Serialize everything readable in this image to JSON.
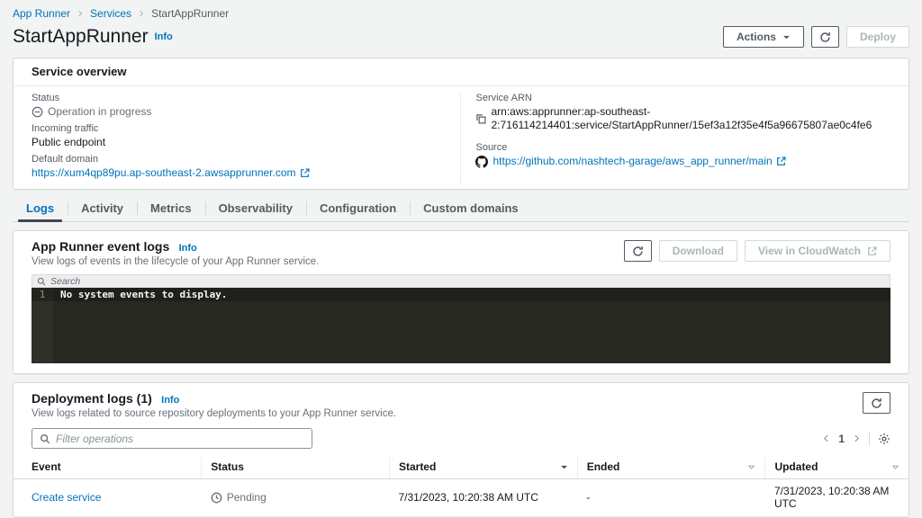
{
  "colors": {
    "link": "#0073bb",
    "active_tab_underline": "#424650",
    "editor_background": "#272822",
    "status_gray": "#687078"
  },
  "breadcrumb": {
    "items": [
      "App Runner",
      "Services",
      "StartAppRunner"
    ]
  },
  "header": {
    "title": "StartAppRunner",
    "info_label": "Info",
    "actions_button": "Actions",
    "deploy_button": "Deploy"
  },
  "service_overview": {
    "title": "Service overview",
    "status_label": "Status",
    "status_value": "Operation in progress",
    "incoming_traffic_label": "Incoming traffic",
    "incoming_traffic_value": "Public endpoint",
    "default_domain_label": "Default domain",
    "default_domain_value": "https://xum4qp89pu.ap-southeast-2.awsapprunner.com",
    "service_arn_label": "Service ARN",
    "service_arn_value": "arn:aws:apprunner:ap-southeast-2:716114214401:service/StartAppRunner/15ef3a12f35e4f5a96675807ae0c4fe6",
    "source_label": "Source",
    "source_value": "https://github.com/nashtech-garage/aws_app_runner/main"
  },
  "tabs": [
    {
      "label": "Logs",
      "active": true
    },
    {
      "label": "Activity",
      "active": false
    },
    {
      "label": "Metrics",
      "active": false
    },
    {
      "label": "Observability",
      "active": false
    },
    {
      "label": "Configuration",
      "active": false
    },
    {
      "label": "Custom domains",
      "active": false
    }
  ],
  "event_logs": {
    "title": "App Runner event logs",
    "info_label": "Info",
    "description": "View logs of events in the lifecycle of your App Runner service.",
    "download_button": "Download",
    "cloudwatch_button": "View in CloudWatch",
    "search_placeholder": "Search",
    "editor": {
      "line_number": "1",
      "message": "No system events to display."
    }
  },
  "deployment_logs": {
    "title": "Deployment logs (1)",
    "info_label": "Info",
    "description": "View logs related to source repository deployments to your App Runner service.",
    "filter_placeholder": "Filter operations",
    "pagination": {
      "page": "1"
    },
    "table": {
      "columns": [
        "Event",
        "Status",
        "Started",
        "Ended",
        "Updated"
      ],
      "rows": [
        {
          "event": "Create service",
          "status": "Pending",
          "started": "7/31/2023, 10:20:38 AM UTC",
          "ended": "-",
          "updated": "7/31/2023, 10:20:38 AM UTC"
        }
      ]
    }
  }
}
